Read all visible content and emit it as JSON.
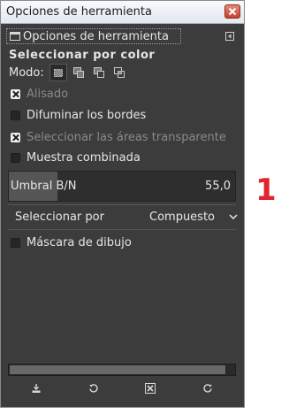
{
  "window": {
    "title": "Opciones de herramienta"
  },
  "tab": {
    "label": "Opciones de herramienta"
  },
  "section": {
    "title": "Seleccionar por color"
  },
  "mode": {
    "label": "Modo:",
    "buttons": [
      "replace-mode-icon",
      "add-mode-icon",
      "subtract-mode-icon",
      "intersect-mode-icon"
    ],
    "active": 0
  },
  "options": {
    "antialias": {
      "label": "Alisado",
      "checked": true,
      "enabled": false
    },
    "feather": {
      "label": "Difuminar los bordes",
      "checked": false,
      "enabled": true
    },
    "transparent": {
      "label": "Seleccionar las áreas transparente",
      "checked": true,
      "enabled": false
    },
    "merged": {
      "label": "Muestra combinada",
      "checked": false,
      "enabled": true
    }
  },
  "threshold": {
    "label": "Umbral B/N",
    "value": "55,0",
    "fraction": 0.216
  },
  "select_by": {
    "label": "Seleccionar por",
    "value": "Compuesto"
  },
  "draw_mask": {
    "label": "Máscara de dibujo",
    "checked": false
  },
  "bottom_buttons": [
    "save-options-icon",
    "restore-options-icon",
    "delete-options-icon",
    "reset-options-icon"
  ],
  "annotation": {
    "text": "1",
    "color": "#e0252b"
  },
  "colors": {
    "panel": "#3c3c3c",
    "text": "#e6e6e6",
    "disabled_text": "#8a8a8a"
  }
}
